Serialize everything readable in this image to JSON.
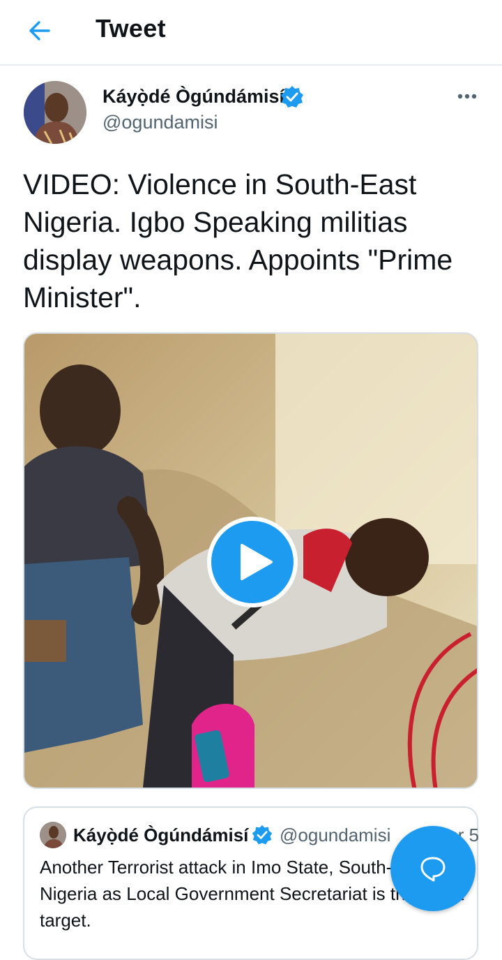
{
  "header": {
    "title": "Tweet",
    "back_icon": "arrow-left-icon"
  },
  "tweet": {
    "author_name": "Káyọ̀dé Ògúndámisí",
    "author_handle": "@ogundamisi",
    "verified": true,
    "text": "VIDEO: Violence in South-East Nigeria. Igbo Speaking militias display weapons. Appoints \"Prime Minister\".",
    "media": {
      "type": "video",
      "play_icon": "play-icon"
    }
  },
  "quoted_tweet": {
    "author_name": "Káyọ̀dé Ògúndámisí",
    "author_handle": "@ogundamisi",
    "separator": "·",
    "date": "Apr 5",
    "text": "Another Terrorist attack in Imo State, South-East Nigeria as Local Government Secretariat is the latest target."
  },
  "colors": {
    "accent": "#1d9bf0",
    "text": "#0f1419",
    "secondary": "#536471",
    "border": "#d6dfe6"
  },
  "fab": {
    "icon": "compose-reply-icon"
  }
}
